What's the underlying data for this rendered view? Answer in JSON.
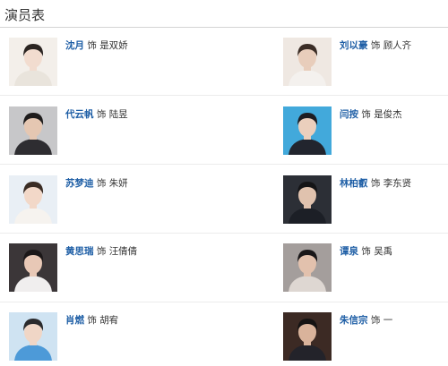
{
  "section_title": "演员表",
  "cast": [
    {
      "actor": "沈月",
      "shi": "饰",
      "role": "是双娇",
      "colors": {
        "bg": "#f3efea",
        "skin": "#f2dccf",
        "hair": "#2b2522",
        "cloth": "#e9e4dc"
      }
    },
    {
      "actor": "刘以豪",
      "shi": "饰",
      "role": "顾人齐",
      "colors": {
        "bg": "#efe8e2",
        "skin": "#e8cdbb",
        "hair": "#3b2d26",
        "cloth": "#f4f1ee"
      }
    },
    {
      "actor": "代云帆",
      "shi": "饰",
      "role": "陆昱",
      "colors": {
        "bg": "#c7c7c9",
        "skin": "#e5c7b2",
        "hair": "#1e1c1c",
        "cloth": "#2e2d31"
      }
    },
    {
      "actor": "闫按",
      "shi": "饰",
      "role": "是俊杰",
      "colors": {
        "bg": "#42a9db",
        "skin": "#ebcfbd",
        "hair": "#1d1d22",
        "cloth": "#22252e"
      }
    },
    {
      "actor": "苏梦迪",
      "shi": "饰",
      "role": "朱妍",
      "colors": {
        "bg": "#e9eff5",
        "skin": "#f2d8c8",
        "hair": "#3a2c24",
        "cloth": "#f6f3ef"
      }
    },
    {
      "actor": "林柏叡",
      "shi": "饰",
      "role": "李东贤",
      "colors": {
        "bg": "#2c2f36",
        "skin": "#e0c2ae",
        "hair": "#141416",
        "cloth": "#1c1f26"
      }
    },
    {
      "actor": "黄思瑞",
      "shi": "饰",
      "role": "汪倩倩",
      "colors": {
        "bg": "#3b3638",
        "skin": "#e8c8b6",
        "hair": "#1b1718",
        "cloth": "#f0eeee"
      }
    },
    {
      "actor": "谭泉",
      "shi": "饰",
      "role": "吴禹",
      "colors": {
        "bg": "#a49e9c",
        "skin": "#e2c1ad",
        "hair": "#191719",
        "cloth": "#ded7d2"
      }
    },
    {
      "actor": "肖燃",
      "shi": "饰",
      "role": "胡宥",
      "colors": {
        "bg": "#cfe3f2",
        "skin": "#f0d6c6",
        "hair": "#2a2a2c",
        "cloth": "#4d9ad8"
      }
    },
    {
      "actor": "朱信宗",
      "shi": "饰",
      "role": "一",
      "colors": {
        "bg": "#3c2a24",
        "skin": "#d9b39b",
        "hair": "#151313",
        "cloth": "#23232a"
      }
    }
  ]
}
